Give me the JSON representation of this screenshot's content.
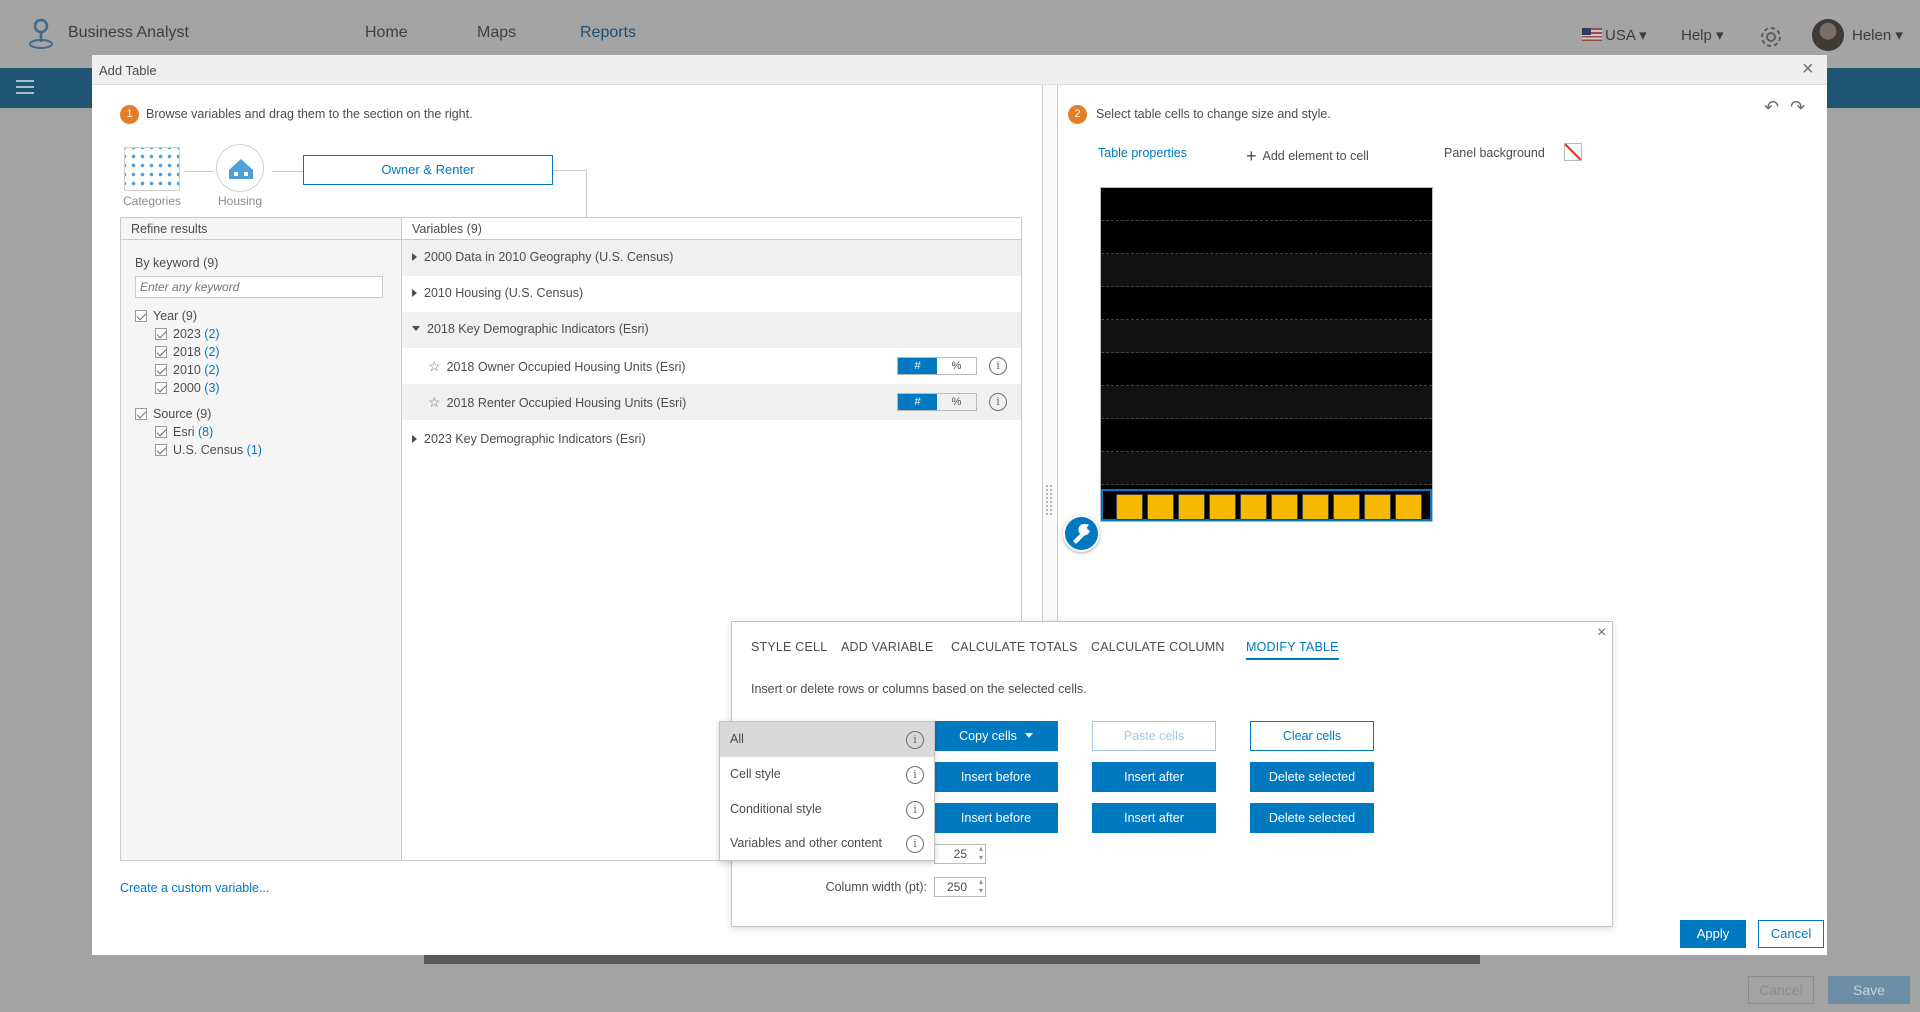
{
  "app": {
    "name": "Business Analyst"
  },
  "nav": {
    "home": "Home",
    "maps": "Maps",
    "reports": "Reports"
  },
  "header": {
    "country": "USA",
    "help": "Help",
    "user": "Helen"
  },
  "background": {
    "cancel": "Cancel",
    "save": "Save"
  },
  "dialog": {
    "title": "Add Table",
    "step1": {
      "num": "1",
      "text": "Browse variables and drag them to the section on the right."
    },
    "step2": {
      "num": "2",
      "text": "Select table cells to change size and style."
    },
    "breadcrumb": {
      "categories": "Categories",
      "housing": "Housing",
      "current": "Owner & Renter"
    },
    "refine": {
      "header": "Refine results",
      "keyword_label": "By keyword (9)",
      "keyword_placeholder": "Enter any keyword",
      "year": {
        "label": "Year (9)",
        "items": [
          {
            "label": "2023",
            "count": "(2)"
          },
          {
            "label": "2018",
            "count": "(2)"
          },
          {
            "label": "2010",
            "count": "(2)"
          },
          {
            "label": "2000",
            "count": "(3)"
          }
        ]
      },
      "source": {
        "label": "Source (9)",
        "items": [
          {
            "label": "Esri",
            "count": "(8)"
          },
          {
            "label": "U.S. Census",
            "count": "(1)"
          }
        ]
      }
    },
    "variables": {
      "header": "Variables (9)",
      "groups": [
        "2000 Data in 2010 Geography (U.S. Census)",
        "2010 Housing (U.S. Census)",
        "2018 Key Demographic Indicators (Esri)",
        "2023 Key Demographic Indicators (Esri)"
      ],
      "items": [
        {
          "label": "2018 Owner Occupied Housing Units (Esri)",
          "hash": "#",
          "pct": "%"
        },
        {
          "label": "2018 Renter Occupied Housing Units (Esri)",
          "hash": "#",
          "pct": "%"
        }
      ]
    },
    "create_link": "Create a custom variable...",
    "toolbar": {
      "table_properties": "Table properties",
      "add_element": "Add element to cell",
      "panel_background": "Panel background"
    },
    "popup": {
      "tabs": [
        "STYLE CELL",
        "ADD VARIABLE",
        "CALCULATE TOTALS",
        "CALCULATE COLUMN",
        "MODIFY TABLE"
      ],
      "description": "Insert or delete rows or columns based on the selected cells.",
      "copy_cells": "Copy cells",
      "paste_cells": "Paste cells",
      "clear_cells": "Clear cells",
      "insert_before": "Insert before",
      "insert_after": "Insert after",
      "delete_selected": "Delete selected",
      "row_height_value": "25",
      "column_width_label": "Column width (pt):",
      "column_width_value": "250"
    },
    "copy_menu": [
      "All",
      "Cell style",
      "Conditional style",
      "Variables and other content"
    ],
    "apply": "Apply",
    "cancel": "Cancel"
  },
  "colors": {
    "accent": "#0079c1",
    "step_badge": "#e47d28",
    "cell_yellow": "#f6b800",
    "nav_bar": "#1f5573"
  }
}
